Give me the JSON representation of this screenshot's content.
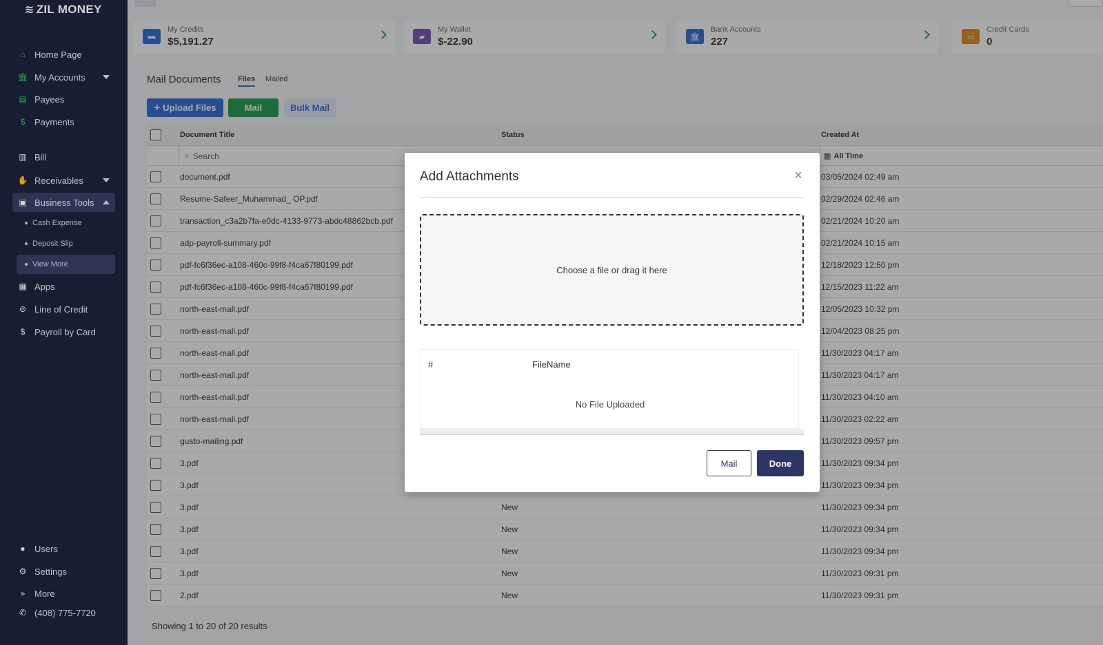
{
  "sidebar": {
    "logo": "ZIL MONEY",
    "items": [
      {
        "label": "Home Page",
        "icon": "home-icon"
      },
      {
        "label": "My Accounts",
        "icon": "bank-icon"
      },
      {
        "label": "Payees",
        "icon": "contact-book-icon"
      },
      {
        "label": "Payments",
        "icon": "dollar-icon"
      },
      {
        "label": "Bill",
        "icon": "bill-icon"
      },
      {
        "label": "Receivables",
        "icon": "hand-money-icon"
      },
      {
        "label": "Business Tools",
        "icon": "briefcase-icon"
      },
      {
        "label": "Apps",
        "icon": "grid-icon"
      },
      {
        "label": "Line of Credit",
        "icon": "money-bag-icon"
      },
      {
        "label": "Payroll by Card",
        "icon": "dollar-icon"
      }
    ],
    "sub_items": [
      "Cash Expense",
      "Deposit Slip",
      "View More"
    ],
    "bottom": [
      {
        "label": "Users",
        "icon": "user-icon"
      },
      {
        "label": "Settings",
        "icon": "gear-icon"
      },
      {
        "label": "More",
        "icon": "double-chevron-icon"
      },
      {
        "label": "(408) 775-7720",
        "icon": "phone-icon"
      }
    ]
  },
  "cards": [
    {
      "label": "My Credits",
      "value": "$5,191.27",
      "color": "#2f6bd8"
    },
    {
      "label": "My Wallet",
      "value": "$-22.90",
      "color": "#7b4fb3"
    },
    {
      "label": "Bank Accounts",
      "value": "227",
      "color": "#2f6bd8"
    },
    {
      "label": "Credit Cards",
      "value": "0",
      "color": "#e08a1e"
    }
  ],
  "page": {
    "title": "Mail Documents",
    "tabs": [
      "Files",
      "Mailed"
    ],
    "buttons": {
      "upload": "Upload Files",
      "mail": "Mail",
      "bulk": "Bulk Mail"
    }
  },
  "table": {
    "columns": [
      "Document Title",
      "Status",
      "Created At"
    ],
    "search_placeholder": "Search",
    "time_filter": "All Time",
    "rows": [
      {
        "title": "document.pdf",
        "status": "",
        "created": "03/05/2024 02:49 am"
      },
      {
        "title": "Resume-Safeer_Muhammad_ OP.pdf",
        "status": "",
        "created": "02/29/2024 02:46 am"
      },
      {
        "title": "transaction_c3a2b7fa-e0dc-4133-9773-abdc48862bcb.pdf",
        "status": "",
        "created": "02/21/2024 10:20 am"
      },
      {
        "title": "adp-payroll-summary.pdf",
        "status": "",
        "created": "02/21/2024 10:15 am"
      },
      {
        "title": "pdf-fc6f36ec-a108-460c-99f8-f4ca67f80199.pdf",
        "status": "",
        "created": "12/18/2023 12:50 pm"
      },
      {
        "title": "pdf-fc6f36ec-a108-460c-99f8-f4ca67f80199.pdf",
        "status": "",
        "created": "12/15/2023 11:22 am"
      },
      {
        "title": "north-east-mall.pdf",
        "status": "",
        "created": "12/05/2023 10:32 pm"
      },
      {
        "title": "north-east-mall.pdf",
        "status": "",
        "created": "12/04/2023 08:25 pm"
      },
      {
        "title": "north-east-mall.pdf",
        "status": "",
        "created": "11/30/2023 04:17 am"
      },
      {
        "title": "north-east-mall.pdf",
        "status": "",
        "created": "11/30/2023 04:17 am"
      },
      {
        "title": "north-east-mall.pdf",
        "status": "",
        "created": "11/30/2023 04:10 am"
      },
      {
        "title": "north-east-mall.pdf",
        "status": "",
        "created": "11/30/2023 02:22 am"
      },
      {
        "title": "gusto-mailing.pdf",
        "status": "",
        "created": "11/30/2023 09:57 pm"
      },
      {
        "title": "3.pdf",
        "status": "",
        "created": "11/30/2023 09:34 pm"
      },
      {
        "title": "3.pdf",
        "status": "",
        "created": "11/30/2023 09:34 pm"
      },
      {
        "title": "3.pdf",
        "status": "New",
        "created": "11/30/2023 09:34 pm"
      },
      {
        "title": "3.pdf",
        "status": "New",
        "created": "11/30/2023 09:34 pm"
      },
      {
        "title": "3.pdf",
        "status": "New",
        "created": "11/30/2023 09:34 pm"
      },
      {
        "title": "3.pdf",
        "status": "New",
        "created": "11/30/2023 09:31 pm"
      },
      {
        "title": "2.pdf",
        "status": "New",
        "created": "11/30/2023 09:31 pm"
      }
    ],
    "footer": "Showing 1 to 20 of 20 results"
  },
  "modal": {
    "title": "Add Attachments",
    "dropzone_text": "Choose a file or drag it here",
    "columns": [
      "#",
      "FileName"
    ],
    "empty_text": "No File Uploaded",
    "buttons": {
      "mail": "Mail",
      "done": "Done"
    }
  }
}
